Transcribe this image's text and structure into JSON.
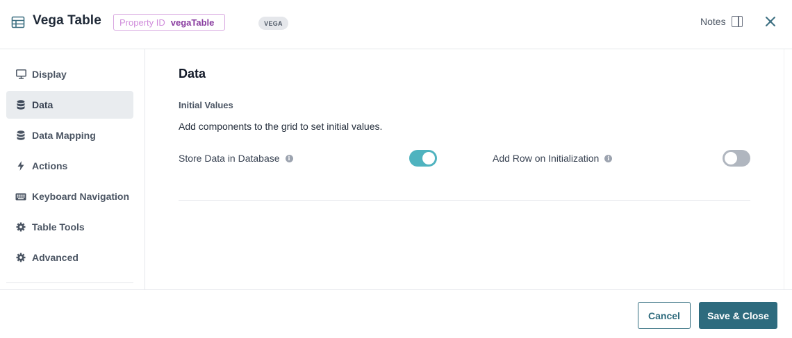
{
  "header": {
    "title": "Vega Table",
    "title_icon": "table-icon",
    "property_id_label": "Property ID",
    "property_id_value": "vegaTable",
    "type_badge": "VEGA",
    "notes_label": "Notes",
    "notes_icon": "panel-icon",
    "close_icon": "close-icon"
  },
  "sidebar": {
    "items": [
      {
        "label": "Display",
        "icon": "monitor-icon",
        "active": false
      },
      {
        "label": "Data",
        "icon": "database-icon",
        "active": true
      },
      {
        "label": "Data Mapping",
        "icon": "database-icon",
        "active": false
      },
      {
        "label": "Actions",
        "icon": "lightning-icon",
        "active": false
      },
      {
        "label": "Keyboard Navigation",
        "icon": "keyboard-icon",
        "active": false
      },
      {
        "label": "Table Tools",
        "icon": "gear-icon",
        "active": false
      },
      {
        "label": "Advanced",
        "icon": "gear-icon",
        "active": false
      }
    ]
  },
  "main": {
    "section_title": "Data",
    "subsection_title": "Initial Values",
    "description": "Add components to the grid to set initial values.",
    "toggles": [
      {
        "label": "Store Data in Database",
        "on": true
      },
      {
        "label": "Add Row on Initialization",
        "on": false
      }
    ]
  },
  "footer": {
    "cancel_label": "Cancel",
    "save_label": "Save & Close"
  },
  "colors": {
    "accent": "#2e6b7e",
    "toggle_on": "#4fb3bf",
    "toggle_off": "#b0b6bf",
    "badge_purple": "#8a3ea0"
  }
}
